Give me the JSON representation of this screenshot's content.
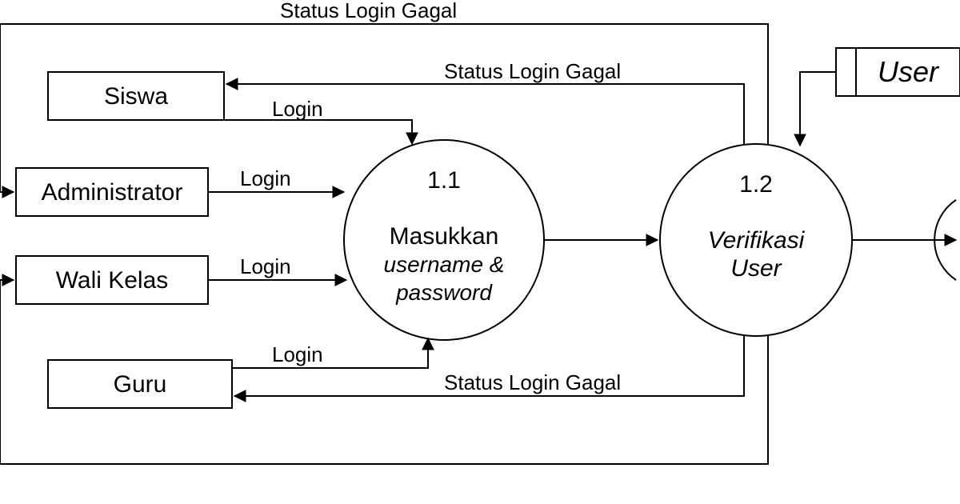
{
  "entities": {
    "siswa": "Siswa",
    "administrator": "Administrator",
    "wali_kelas": "Wali Kelas",
    "guru": "Guru",
    "user": "User"
  },
  "processes": {
    "p11": {
      "number": "1.1",
      "line1": "Masukkan",
      "line2": "username &",
      "line3": "password"
    },
    "p12": {
      "number": "1.2",
      "line1": "Verifikasi",
      "line2": "User"
    }
  },
  "flows": {
    "login": "Login",
    "status_login_gagal": "Status Login Gagal"
  }
}
